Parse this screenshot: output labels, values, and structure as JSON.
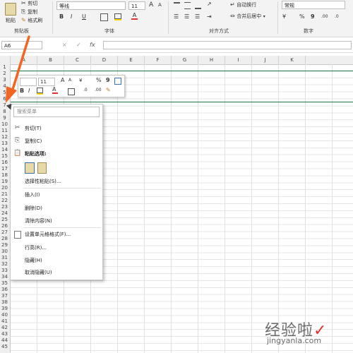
{
  "ribbon": {
    "clipboard": {
      "paste": "粘贴",
      "cut": "剪切",
      "copy": "复制",
      "format_painter": "格式刷",
      "label": "剪贴板"
    },
    "font": {
      "name": "等线",
      "size": "11",
      "bold": "B",
      "italic": "I",
      "underline": "U",
      "grow": "A",
      "shrink": "A",
      "color_a": "A",
      "label": "字体"
    },
    "alignment": {
      "wrap": "自动换行",
      "merge": "合并后居中",
      "label": "对齐方式"
    },
    "number": {
      "format": "常规",
      "percent": "%",
      "comma": "9",
      "label": "数字"
    }
  },
  "formula_bar": {
    "name_box": "A6",
    "cancel": "×",
    "confirm": "✓",
    "fx": "fx"
  },
  "columns": [
    "A",
    "B",
    "C",
    "D",
    "E",
    "F",
    "G",
    "H",
    "I",
    "J",
    "K"
  ],
  "rows": [
    "1",
    "2",
    "3",
    "4",
    "5",
    "6",
    "7",
    "8",
    "9",
    "10",
    "11",
    "12",
    "13",
    "14",
    "15",
    "16",
    "17",
    "18",
    "19",
    "20",
    "21",
    "22",
    "23",
    "24",
    "25",
    "26",
    "27",
    "28",
    "29",
    "30",
    "31",
    "32",
    "33",
    "34",
    "35",
    "36",
    "37",
    "38",
    "39",
    "40",
    "41",
    "42",
    "43",
    "44",
    "45"
  ],
  "mini_toolbar": {
    "font_size": "11",
    "grow": "A",
    "shrink": "A",
    "percent": "%",
    "comma": "9",
    "bold": "B",
    "italic": "I",
    "font_color": "A"
  },
  "context_menu": {
    "search_placeholder": "搜索菜单",
    "cut": "剪切(T)",
    "copy": "复制(C)",
    "paste_options": "粘贴选项:",
    "paste_special": "选择性粘贴(S)...",
    "insert": "插入(I)",
    "delete": "删除(D)",
    "clear": "清除内容(N)",
    "format_cells": "设置单元格格式(F)...",
    "row_height": "行高(R)...",
    "hide": "隐藏(H)",
    "unhide": "取消隐藏(U)"
  },
  "watermark": {
    "title": "经验啦",
    "url": "jingyanla.com"
  },
  "colors": {
    "accent_green": "#1e7145",
    "arrow": "#f26522",
    "ribbon_bg": "#f3f3f3"
  }
}
